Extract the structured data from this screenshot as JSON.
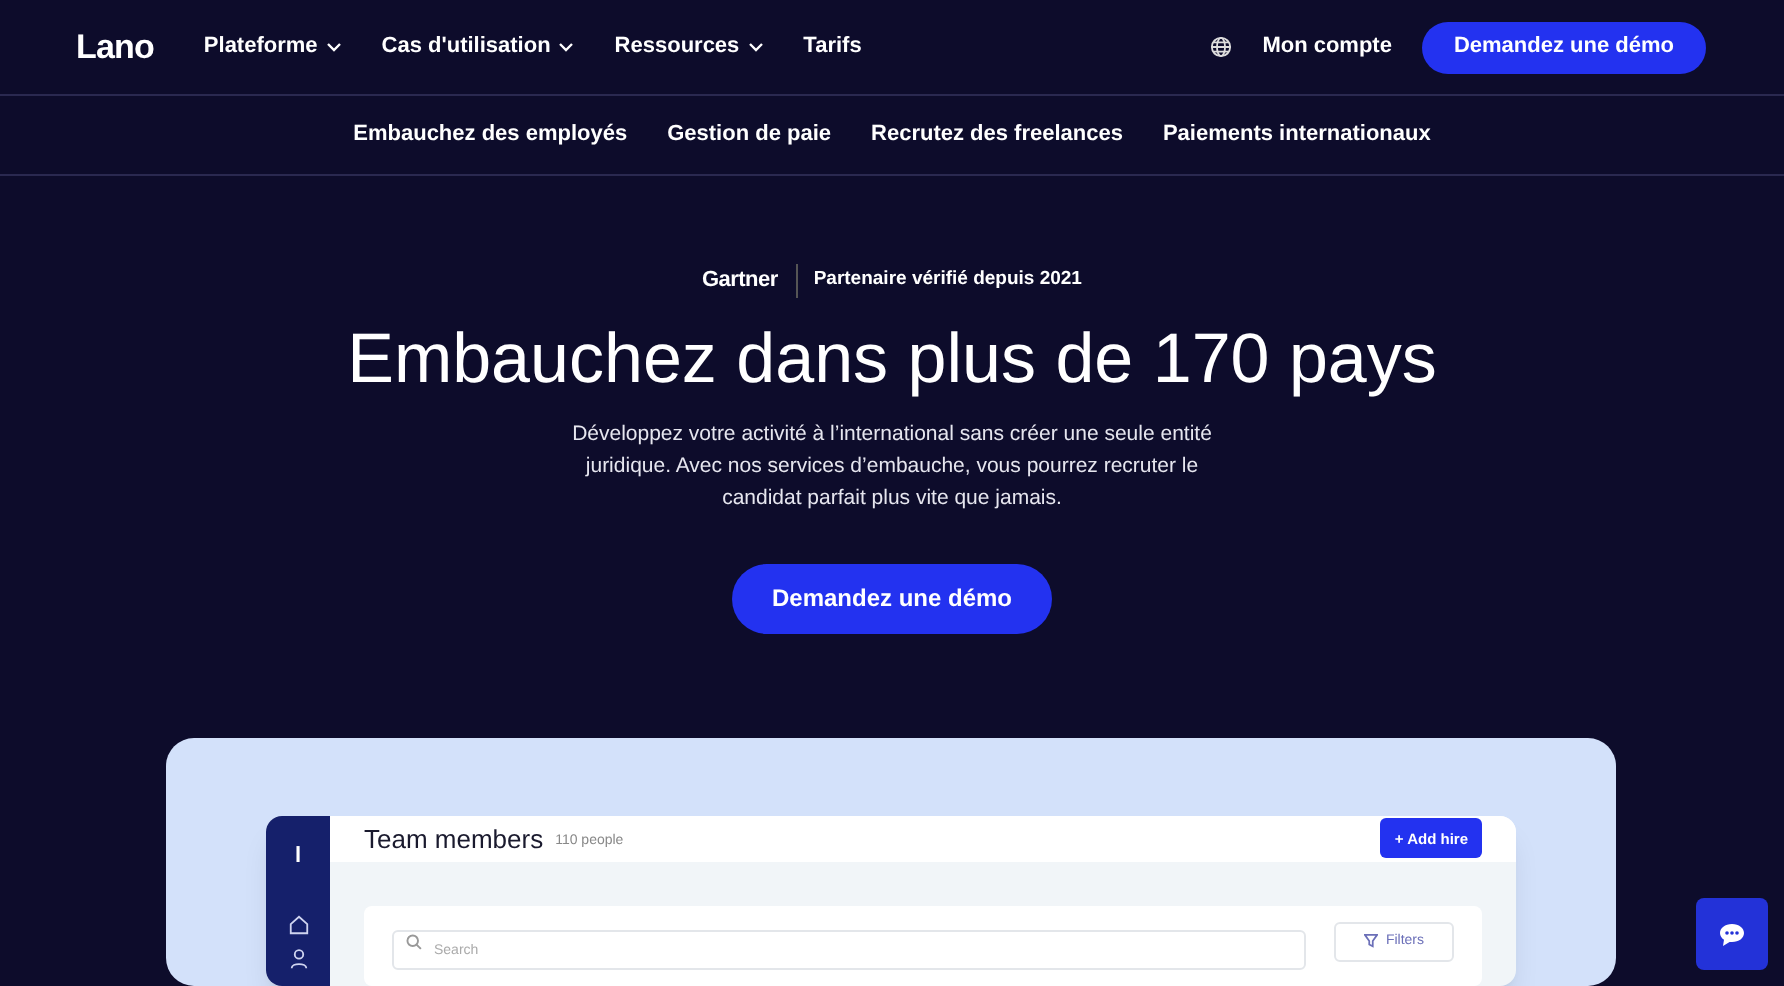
{
  "header": {
    "logo": "Lano",
    "nav": [
      {
        "label": "Plateforme",
        "dropdown": true
      },
      {
        "label": "Cas d'utilisation",
        "dropdown": true
      },
      {
        "label": "Ressources",
        "dropdown": true
      },
      {
        "label": "Tarifs",
        "dropdown": false
      }
    ],
    "account": "Mon compte",
    "cta": "Demandez une démo"
  },
  "subnav": [
    "Embauchez des employés",
    "Gestion de paie",
    "Recrutez des freelances",
    "Paiements internationaux"
  ],
  "hero": {
    "badge_brand": "Gartner",
    "badge_text": "Partenaire vérifié depuis 2021",
    "title": "Embauchez dans plus de 170 pays",
    "text": "Développez votre activité à l’international sans créer une seule entité juridique. Avec nos services d’embauche, vous pourrez recruter le candidat parfait plus vite que jamais.",
    "cta": "Demandez une démo"
  },
  "app_preview": {
    "logo": "l",
    "title": "Team members",
    "count": "110 people",
    "add_button": "+ Add hire",
    "search_placeholder": "Search",
    "filters": "Filters"
  }
}
